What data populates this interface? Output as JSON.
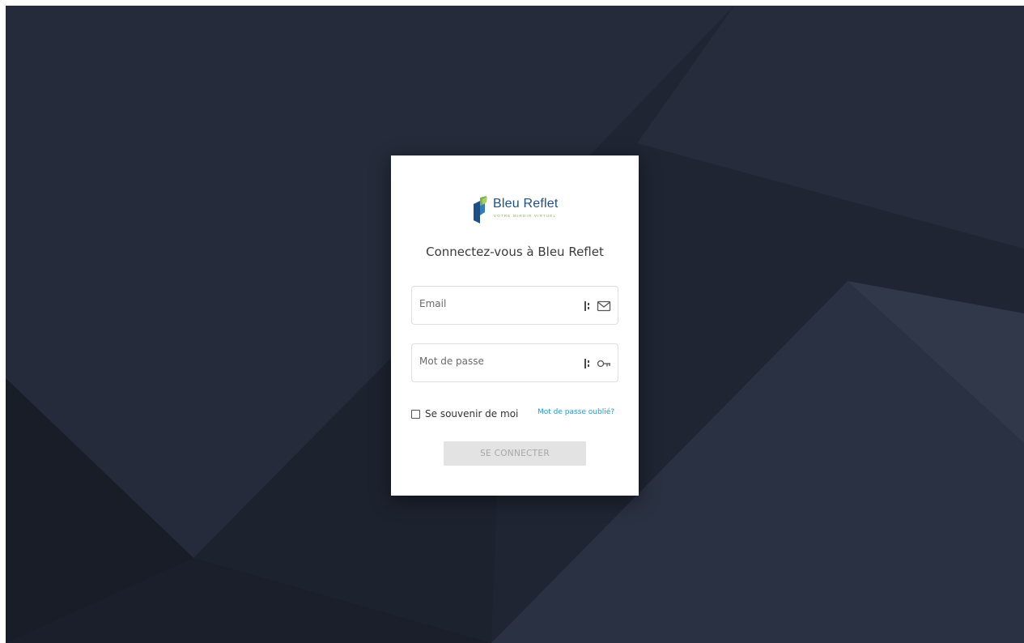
{
  "brand": {
    "name": "Bleu Reflet",
    "tagline": "VOTRE MIROIR VIRTUEL"
  },
  "login": {
    "title": "Connectez-vous à Bleu Reflet",
    "email": {
      "value": "",
      "placeholder": "Email",
      "icon": "envelope-icon"
    },
    "password": {
      "value": "",
      "placeholder": "Mot de passe",
      "icon": "key-icon"
    },
    "remember_me": {
      "label": "Se souvenir de moi",
      "checked": false
    },
    "forgot_password": "Mot de passe oublié?",
    "submit_label": "SE CONNECTER"
  },
  "colors": {
    "background": "#1e2431",
    "brand_blue": "#1d4f86",
    "brand_green": "#7fb24d",
    "link": "#1e9bd6",
    "button_disabled": "#e3e3e3"
  }
}
